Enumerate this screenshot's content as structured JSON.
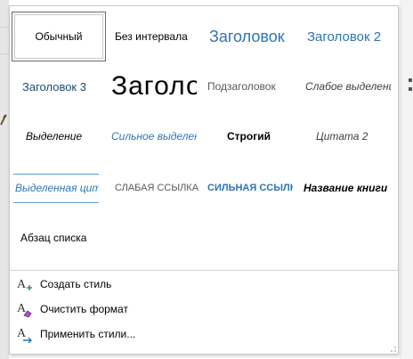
{
  "styles": [
    {
      "label": "Обычный",
      "selected": true
    },
    {
      "label": "Без интервала"
    },
    {
      "label": "Заголовок"
    },
    {
      "label": "Заголовок 2"
    },
    {
      "label": "Заголовок 3"
    },
    {
      "label": "Заголовок"
    },
    {
      "label": "Подзаголовок"
    },
    {
      "label": "Слабое выделение"
    },
    {
      "label": "Выделение"
    },
    {
      "label": "Сильное выделение"
    },
    {
      "label": "Строгий"
    },
    {
      "label": "Цитата 2"
    },
    {
      "label": "Выделенная цитата"
    },
    {
      "label": "СЛАБАЯ ССЫЛКА"
    },
    {
      "label": "СИЛЬНАЯ ССЫЛКА"
    },
    {
      "label": "Название книги"
    },
    {
      "label": "Абзац списка"
    }
  ],
  "commands": {
    "create": {
      "label": "Создать стиль",
      "icon": "create-style-icon"
    },
    "clear": {
      "label": "Очистить формат",
      "icon": "clear-formatting-icon"
    },
    "apply": {
      "label": "Применить стили...",
      "icon": "apply-styles-icon"
    }
  },
  "colors": {
    "accent": "#2e74b5",
    "accent_light": "#5b9bd5",
    "eraser": "#b04cc4",
    "plus": "#2e9e4a"
  }
}
